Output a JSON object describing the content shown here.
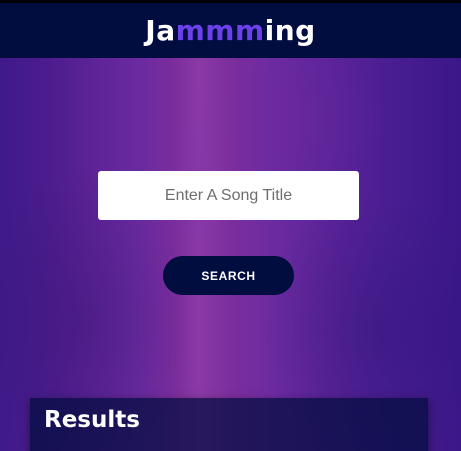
{
  "header": {
    "logo": {
      "part1": "Ja",
      "accent": "mmm",
      "part2": "ing"
    }
  },
  "search": {
    "placeholder": "Enter A Song Title",
    "value": "",
    "button_label": "SEARCH"
  },
  "results": {
    "title": "Results"
  },
  "colors": {
    "header_bg": "#010c3f",
    "logo_accent": "#6c41ec",
    "button_bg": "#010c3f",
    "background": "#5a2196"
  }
}
